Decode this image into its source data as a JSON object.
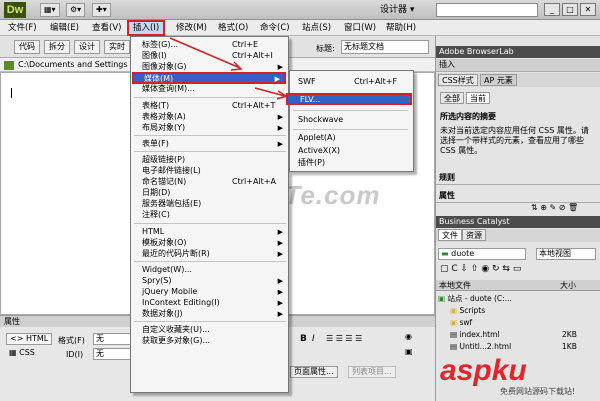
{
  "app": {
    "logo": "Dw",
    "designer": "设计器 ▾"
  },
  "menubar": [
    "文件(F)",
    "编辑(E)",
    "查看(V)",
    "插入(I)",
    "修改(M)",
    "格式(O)",
    "命令(C)",
    "站点(S)",
    "窗口(W)",
    "帮助(H)"
  ],
  "doc_toolbar": {
    "code": "代码",
    "split": "拆分",
    "design": "设计",
    "realtime": "实时",
    "title_label": "标题:",
    "title_value": "无标题文档"
  },
  "doc_path": "C:\\Documents and Settings",
  "watermark": "www.DuoTe.com",
  "insert_menu": [
    {
      "label": "标签(G)...",
      "shortcut": "Ctrl+E"
    },
    {
      "label": "图像(I)",
      "shortcut": "Ctrl+Alt+I"
    },
    {
      "label": "图像对象(G)",
      "arrow": true
    },
    {
      "label": "媒体(M)",
      "arrow": true,
      "highlight": true
    },
    {
      "label": "媒体查询(M)..."
    },
    {
      "sep": true
    },
    {
      "label": "表格(T)",
      "shortcut": "Ctrl+Alt+T"
    },
    {
      "label": "表格对象(A)",
      "arrow": true
    },
    {
      "label": "布局对象(Y)",
      "arrow": true
    },
    {
      "sep": true
    },
    {
      "label": "表单(F)",
      "arrow": true
    },
    {
      "sep": true
    },
    {
      "label": "超级链接(P)"
    },
    {
      "label": "电子邮件链接(L)"
    },
    {
      "label": "命名锚记(N)",
      "shortcut": "Ctrl+Alt+A"
    },
    {
      "label": "日期(D)"
    },
    {
      "label": "服务器端包括(E)"
    },
    {
      "label": "注释(C)"
    },
    {
      "sep": true
    },
    {
      "label": "HTML",
      "arrow": true
    },
    {
      "label": "模板对象(O)",
      "arrow": true
    },
    {
      "label": "最近的代码片断(R)",
      "arrow": true
    },
    {
      "sep": true
    },
    {
      "label": "Widget(W)..."
    },
    {
      "label": "Spry(S)",
      "arrow": true
    },
    {
      "label": "jQuery Mobile",
      "arrow": true
    },
    {
      "label": "InContext Editing(I)",
      "arrow": true
    },
    {
      "label": "数据对象(J)",
      "arrow": true
    },
    {
      "sep": true
    },
    {
      "label": "自定义收藏夹(U)..."
    },
    {
      "label": "获取更多对象(G)..."
    }
  ],
  "media_menu": [
    {
      "label": "SWF",
      "shortcut": "Ctrl+Alt+F"
    },
    {
      "label": "FLV..."
    },
    {
      "label": "Shockwave"
    },
    {
      "label": "Applet(A)"
    },
    {
      "label": "ActiveX(X)"
    },
    {
      "label": "插件(P)"
    }
  ],
  "panels": {
    "browserlab": "Adobe BrowserLab",
    "insert": "插入",
    "css_tab": "CSS样式",
    "ap_tab": "AP 元素",
    "all": "全部",
    "current": "当前",
    "summary_title": "所选内容的摘要",
    "summary_text": "未对当前选定内容应用任何 CSS 属性。请选择一个带样式的元素，查看应用了哪些 CSS 属性。",
    "rules": "规则",
    "properties": "属性",
    "business": "Business Catalyst",
    "files_tab": "文件",
    "assets_tab": "资源",
    "site_select": "duote",
    "view_select": "本地视图",
    "col_local": "本地文件",
    "col_size": "大小",
    "files": [
      {
        "name": "站点 - duote (C:...",
        "size": ""
      },
      {
        "name": "Scripts",
        "size": ""
      },
      {
        "name": "swf",
        "size": ""
      },
      {
        "name": "index.html",
        "size": "2KB"
      },
      {
        "name": "Untitl...2.html",
        "size": "1KB"
      }
    ]
  },
  "properties_panel": {
    "title": "属性",
    "html": "HTML",
    "css": "CSS",
    "format_label": "格式(F)",
    "format_value": "无",
    "id_label": "ID(I)",
    "id_value": "无",
    "page_props": "页面属性...",
    "list_item": "列表项目..."
  },
  "site_logo": "aspku",
  "site_logo_sub": "免费网站源码下载站!"
}
